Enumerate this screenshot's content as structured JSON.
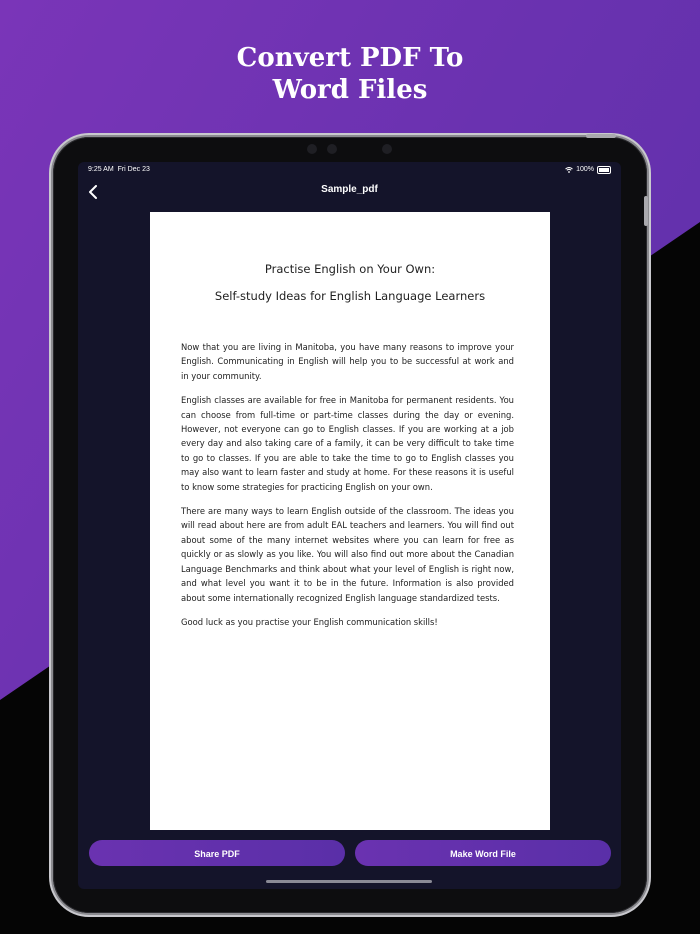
{
  "headline": {
    "line1": "Convert PDF To",
    "line2": "Word Files"
  },
  "status_bar": {
    "time": "9:25 AM",
    "date": "Fri Dec 23",
    "battery": "100%"
  },
  "navbar": {
    "back_icon": "chevron-left-icon",
    "title": "Sample_pdf"
  },
  "document": {
    "title": "Practise English on Your Own:",
    "subtitle": "Self-study Ideas for English Language Learners",
    "paragraphs": [
      "Now that you are living in Manitoba, you have many reasons to improve your English. Communicating in English will help you to be successful at work and in your community.",
      "English classes are available for free in Manitoba for permanent residents. You can choose from full-time or part-time classes during the day or evening. However, not everyone can go to English classes. If you are working at a job every day and also taking care of a family, it can be very difficult to take time to go to classes. If you are able to take the time to go to English classes you may also want to learn faster and study at home. For these reasons it is useful to know some strategies for practicing English on your own.",
      "There are many ways to learn English outside of the classroom. The ideas you will read about here are from adult EAL teachers and learners. You will find out about some of the many internet websites where you can learn for free as quickly or as slowly as you like. You will also find out more about the Canadian Language Benchmarks and think about what your level of English is right now, and what level you want it to be in the future. Information is also provided about some internationally recognized English language standardized tests.",
      "Good luck as you practise your English communication skills!"
    ]
  },
  "actions": {
    "share_label": "Share PDF",
    "make_word_label": "Make Word File"
  },
  "colors": {
    "accent": "#6a32b0",
    "screen_bg": "#14142a"
  }
}
